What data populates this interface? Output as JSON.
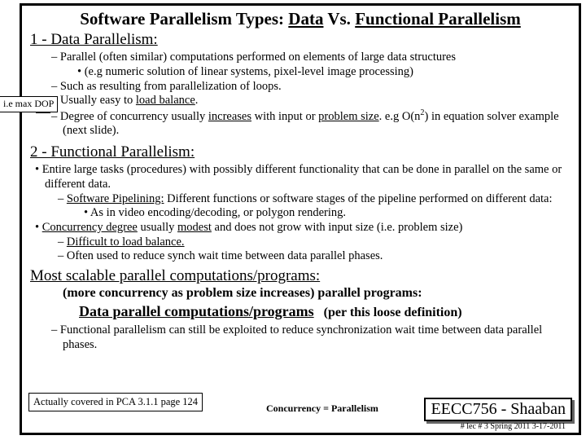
{
  "title": {
    "pre": "Software Parallelism Types: ",
    "u1": "Data",
    "mid": " Vs. ",
    "u2": "Functional Parallelism"
  },
  "sec1": {
    "heading": "1 - Data Parallelism:",
    "b1_pre": "– Parallel (often similar) computations performed on elements of large data structures",
    "b1_sub": "• (e.g numeric solution of linear systems, pixel-level image processing)",
    "b2": "– Such as resulting from parallelization of loops.",
    "b3_pre": "– Usually easy to ",
    "b3_u": "load balance",
    "b3_post": ".",
    "b4_pre": "– Degree of concurrency usually ",
    "b4_u1": "increases",
    "b4_mid": " with input or ",
    "b4_u2": "problem size",
    "b4_post": ". e.g O(n",
    "b4_sup": "2",
    "b4_end": ") in equation solver example (next slide)."
  },
  "callout": "i.e max DOP",
  "sec2": {
    "heading": "2 - Functional Parallelism:",
    "b1": "• Entire large tasks (procedures) with possibly different functionality that can be done in parallel on the same or different data.",
    "b1a_pre": "– ",
    "b1a_u": "Software Pipelining:",
    "b1a_post": " Different functions or software stages of the pipeline performed on different data:",
    "b1a1": "• As in video encoding/decoding, or polygon rendering.",
    "b2_pre": "• ",
    "b2_u1": "Concurrency degree",
    "b2_mid": " usually ",
    "b2_u2": "modest",
    "b2_post": " and does not grow with input size (i.e. problem size)",
    "b2a_pre": "– ",
    "b2a_u": "Difficult to load balance.",
    "b2b": "– Often used to reduce synch wait time between data parallel phases."
  },
  "scalable": "Most scalable parallel computations/programs:",
  "scalable_sub": "(more concurrency as problem size increases) parallel programs:",
  "data_par": "Data parallel computations/programs",
  "loose": "(per this loose definition)",
  "func_note": "– Functional parallelism can still be exploited to reduce synchronization wait time between data parallel phases.",
  "footnote": "Actually covered in PCA 3.1.1 page 124",
  "concurrency": "Concurrency = Parallelism",
  "course": "EECC756 - Shaaban",
  "lecinfo": "# lec # 3 Spring 2011 3-17-2011"
}
